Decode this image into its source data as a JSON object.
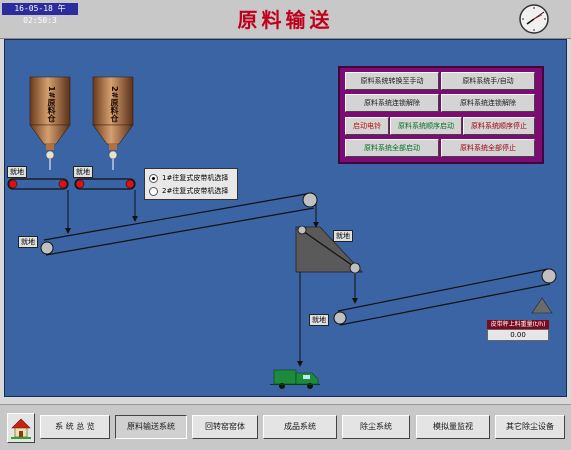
{
  "header": {
    "datetime": "16-05-18 午 02:50:3",
    "title": "原料输送"
  },
  "silos": [
    {
      "label": "1#原料仓"
    },
    {
      "label": "2#原料仓"
    }
  ],
  "tags": {
    "local1": "就地",
    "local2": "就地",
    "local3": "就地",
    "local4": "就地",
    "local5": "就地"
  },
  "radio": {
    "options": [
      "1#往复式皮带机选择",
      "2#往复式皮带机选择"
    ],
    "selected": 0
  },
  "control_panel": {
    "buttons": [
      "原料系统转换至手动",
      "原料系统手/自动",
      "原料系统连锁解除",
      "原料系统连锁解除",
      "启动电铃",
      "原料系统顺序启动",
      "原料系统顺序停止",
      "原料系统全部启动",
      "原料系统全部停止"
    ]
  },
  "weigher": {
    "label": "皮带秤上料重量(t/h)",
    "value": "0.00"
  },
  "colors": {
    "title_red": "#c0001a",
    "bell_red": "#c01010",
    "start_green": "#007020",
    "stop_red": "#a00010"
  },
  "nav": {
    "items": [
      "系 统 总 览",
      "原料输送系统",
      "回转窑窑体",
      "成品系统",
      "除尘系统",
      "模拟量监视",
      "其它除尘设备"
    ],
    "active": 1
  }
}
